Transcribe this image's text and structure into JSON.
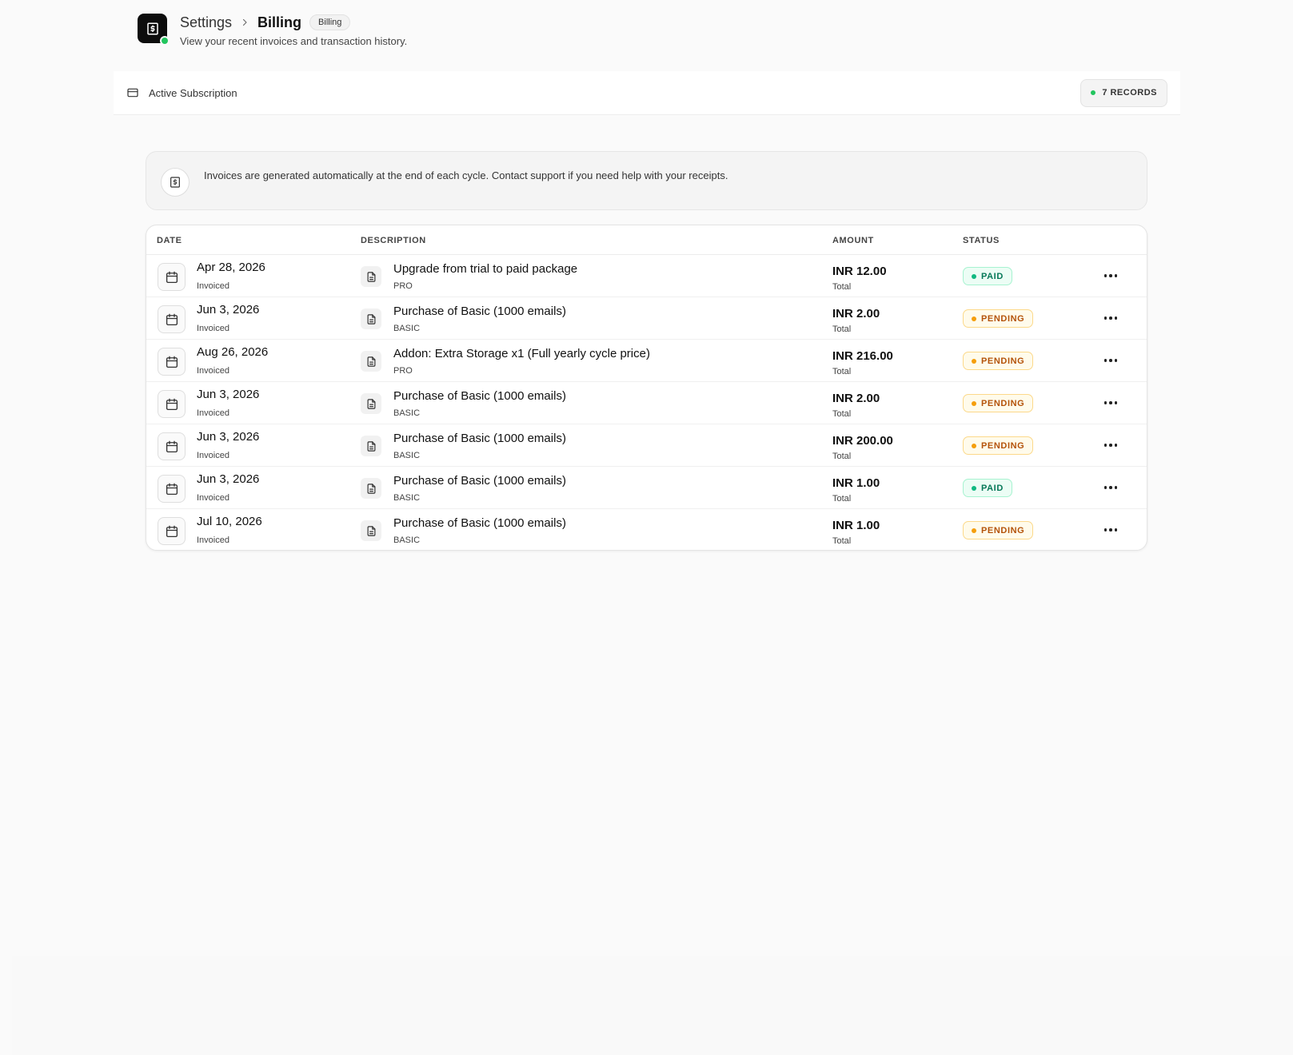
{
  "header": {
    "app_icon": "dollar-receipt-icon",
    "breadcrumb_parent": "Settings",
    "breadcrumb_current": "Billing",
    "pill": "Billing",
    "subtitle": "View your recent invoices and transaction history."
  },
  "subscription": {
    "icon": "credit-card-icon",
    "label": "Active Subscription",
    "records_label": "7 RECORDS"
  },
  "info": {
    "icon": "dollar-receipt-icon",
    "text": "Invoices are generated automatically at the end of each cycle. Contact support if you need help with your receipts."
  },
  "table": {
    "columns": [
      "DATE",
      "DESCRIPTION",
      "AMOUNT",
      "STATUS"
    ],
    "rows": [
      {
        "date": "Apr 28, 2026",
        "date_sub": "Invoiced",
        "desc": "Upgrade from trial to paid package",
        "plan": "PRO",
        "amount": "INR 12.00",
        "amount_sub": "Total",
        "status": "PAID",
        "status_type": "paid"
      },
      {
        "date": "Jun 3, 2026",
        "date_sub": "Invoiced",
        "desc": "Purchase of Basic (1000 emails)",
        "plan": "BASIC",
        "amount": "INR 2.00",
        "amount_sub": "Total",
        "status": "PENDING",
        "status_type": "pending"
      },
      {
        "date": "Aug 26, 2026",
        "date_sub": "Invoiced",
        "desc": "Addon: Extra Storage x1 (Full yearly cycle price)",
        "plan": "PRO",
        "amount": "INR 216.00",
        "amount_sub": "Total",
        "status": "PENDING",
        "status_type": "pending"
      },
      {
        "date": "Jun 3, 2026",
        "date_sub": "Invoiced",
        "desc": "Purchase of Basic (1000 emails)",
        "plan": "BASIC",
        "amount": "INR 2.00",
        "amount_sub": "Total",
        "status": "PENDING",
        "status_type": "pending"
      },
      {
        "date": "Jun 3, 2026",
        "date_sub": "Invoiced",
        "desc": "Purchase of Basic (1000 emails)",
        "plan": "BASIC",
        "amount": "INR 200.00",
        "amount_sub": "Total",
        "status": "PENDING",
        "status_type": "pending"
      },
      {
        "date": "Jun 3, 2026",
        "date_sub": "Invoiced",
        "desc": "Purchase of Basic (1000 emails)",
        "plan": "BASIC",
        "amount": "INR 1.00",
        "amount_sub": "Total",
        "status": "PAID",
        "status_type": "paid"
      },
      {
        "date": "Jul 10, 2026",
        "date_sub": "Invoiced",
        "desc": "Purchase of Basic (1000 emails)",
        "plan": "BASIC",
        "amount": "INR 1.00",
        "amount_sub": "Total",
        "status": "PENDING",
        "status_type": "pending"
      }
    ]
  },
  "colors": {
    "paid": "#10b981",
    "pending": "#f59e0b",
    "status_online": "#22c55e"
  }
}
